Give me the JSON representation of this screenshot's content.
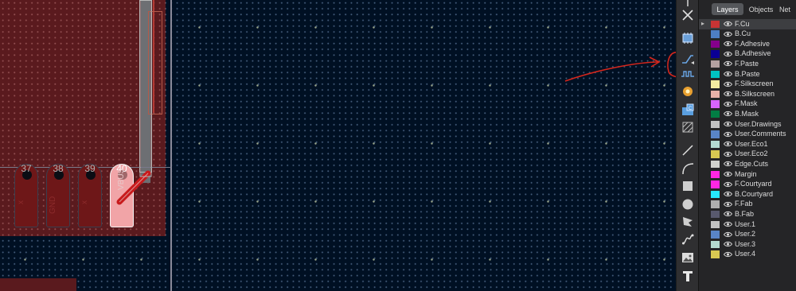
{
  "panel": {
    "tabs": [
      {
        "label": "Layers",
        "active": true
      },
      {
        "label": "Objects",
        "active": false
      },
      {
        "label": "Net",
        "active": false
      }
    ],
    "active_marker": "▸",
    "layers": [
      {
        "name": "F.Cu",
        "color": "#c83434",
        "active": true
      },
      {
        "name": "B.Cu",
        "color": "#4d7fc4"
      },
      {
        "name": "F.Adhesive",
        "color": "#84008b"
      },
      {
        "name": "B.Adhesive",
        "color": "#0a0094"
      },
      {
        "name": "F.Paste",
        "color": "#b4a0a0"
      },
      {
        "name": "B.Paste",
        "color": "#00c2c2"
      },
      {
        "name": "F.Silkscreen",
        "color": "#f2eda1"
      },
      {
        "name": "B.Silkscreen",
        "color": "#e8b2a7"
      },
      {
        "name": "F.Mask",
        "color": "#d864ff"
      },
      {
        "name": "B.Mask",
        "color": "#027d44"
      },
      {
        "name": "User.Drawings",
        "color": "#c2c2c2"
      },
      {
        "name": "User.Comments",
        "color": "#5984c7"
      },
      {
        "name": "User.Eco1",
        "color": "#b4dbd2"
      },
      {
        "name": "User.Eco2",
        "color": "#d8c852"
      },
      {
        "name": "Edge.Cuts",
        "color": "#d0d2cd"
      },
      {
        "name": "Margin",
        "color": "#ff26e2"
      },
      {
        "name": "F.Courtyard",
        "color": "#ff26e2"
      },
      {
        "name": "B.Courtyard",
        "color": "#26e9ff"
      },
      {
        "name": "F.Fab",
        "color": "#afafaf"
      },
      {
        "name": "B.Fab",
        "color": "#58596e"
      },
      {
        "name": "User.1",
        "color": "#c2c2c2"
      },
      {
        "name": "User.2",
        "color": "#5984c7"
      },
      {
        "name": "User.3",
        "color": "#b4dbd2"
      },
      {
        "name": "User.4",
        "color": "#d8c852"
      }
    ]
  },
  "toolbar": {
    "tools": [
      {
        "name": "select-icon"
      },
      {
        "name": "no-connect-icon"
      },
      {
        "name": "add-footprint-icon"
      },
      {
        "name": "route-track-icon",
        "highlighted": true
      },
      {
        "name": "tune-length-icon",
        "highlighted": true
      },
      {
        "name": "add-via-icon"
      },
      {
        "name": "add-zone-icon"
      },
      {
        "name": "rule-area-icon"
      },
      {
        "name": "draw-line-icon"
      },
      {
        "name": "draw-arc-icon"
      },
      {
        "name": "draw-rectangle-icon"
      },
      {
        "name": "draw-circle-icon"
      },
      {
        "name": "draw-polygon-icon"
      },
      {
        "name": "draw-bezier-icon"
      },
      {
        "name": "add-image-icon"
      },
      {
        "name": "add-text-icon"
      }
    ]
  },
  "canvas": {
    "pads": [
      {
        "number": "37",
        "label": "x",
        "highlighted": false
      },
      {
        "number": "38",
        "label": "GND",
        "highlighted": false
      },
      {
        "number": "39",
        "label": "x",
        "highlighted": false
      },
      {
        "number": "40",
        "label": "VBUS",
        "highlighted": true
      }
    ]
  },
  "colors": {
    "canvas_bg": "#001023",
    "copper_fill": "#5a1a1e",
    "track_red": "#c81a1c",
    "annotation": "#d6261c"
  }
}
